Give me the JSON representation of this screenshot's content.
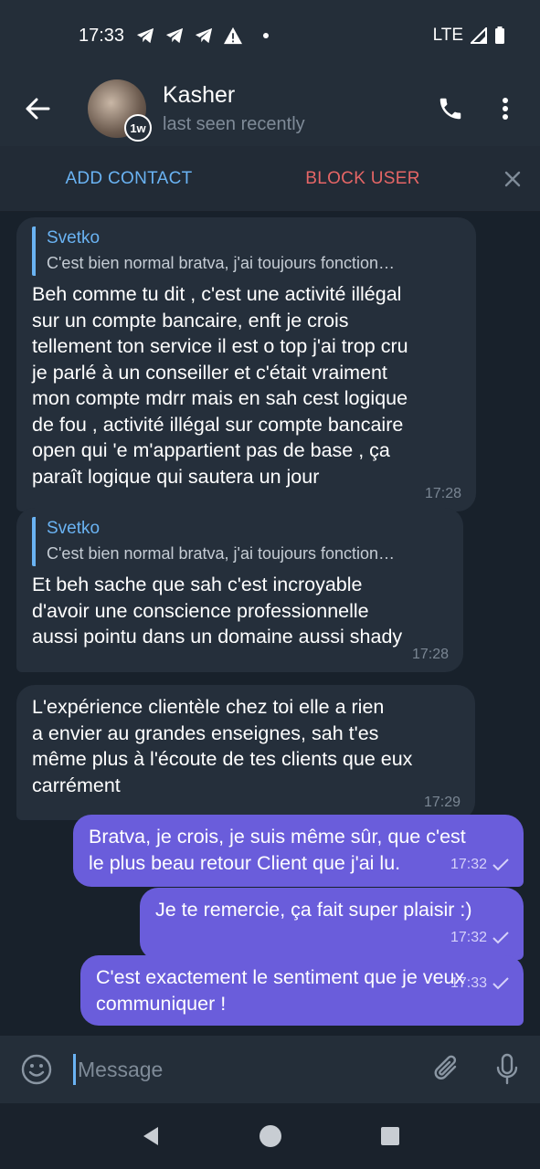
{
  "status_bar": {
    "time": "17:33",
    "network": "LTE"
  },
  "header": {
    "contact_name": "Kasher",
    "contact_status": "last seen recently",
    "avatar_badge": "1w"
  },
  "action_bar": {
    "add_contact": "ADD CONTACT",
    "block_user": "BLOCK USER"
  },
  "messages": [
    {
      "type": "incoming",
      "reply_name": "Svetko",
      "reply_text": "C'est bien normal bratva, j'ai toujours fonction…",
      "text": "Beh comme tu dit , c'est une activité illégal\nsur un compte bancaire, enft je crois\ntellement ton service il est o top j'ai trop cru\nje parlé à un conseiller et c'était vraiment\nmon compte mdrr mais en sah cest logique\nde fou , activité illégal sur compte bancaire\nopen qui 'e m'appartient pas de base , ça\nparaît logique qui sautera un jour",
      "time": "17:28"
    },
    {
      "type": "incoming",
      "reply_name": "Svetko",
      "reply_text": "C'est bien normal bratva, j'ai toujours fonction…",
      "text": "Et beh sache que sah c'est incroyable\nd'avoir une conscience professionnelle\naussi pointu dans un domaine aussi shady",
      "time": "17:28"
    },
    {
      "type": "incoming",
      "text": "L'expérience clientèle chez toi elle a rien\na envier au grandes enseignes, sah t'es\nmême plus à l'écoute de tes clients que eux\ncarrément",
      "time": "17:29"
    },
    {
      "type": "outgoing",
      "text": "Bratva, je crois, je suis même sûr, que c'est\nle plus beau retour Client que j'ai lu.",
      "time": "17:32"
    },
    {
      "type": "outgoing",
      "text": "Je te remercie, ça fait super plaisir :)",
      "time": "17:32"
    },
    {
      "type": "outgoing",
      "text": "C'est exactement le sentiment que je veux\ncommuniquer !",
      "time": "17:33"
    }
  ],
  "input": {
    "placeholder": "Message"
  },
  "icons": {
    "back": "arrow-left-icon",
    "call": "phone-icon",
    "menu": "more-vertical-icon",
    "close": "close-icon",
    "emoji": "emoji-icon",
    "attach": "paperclip-icon",
    "mic": "microphone-icon",
    "read": "check-icon"
  },
  "colors": {
    "accent": "#6ab3f3",
    "block": "#e66666",
    "outgoing_bubble": "#6a5ddb",
    "incoming_bubble": "#252f3b"
  }
}
